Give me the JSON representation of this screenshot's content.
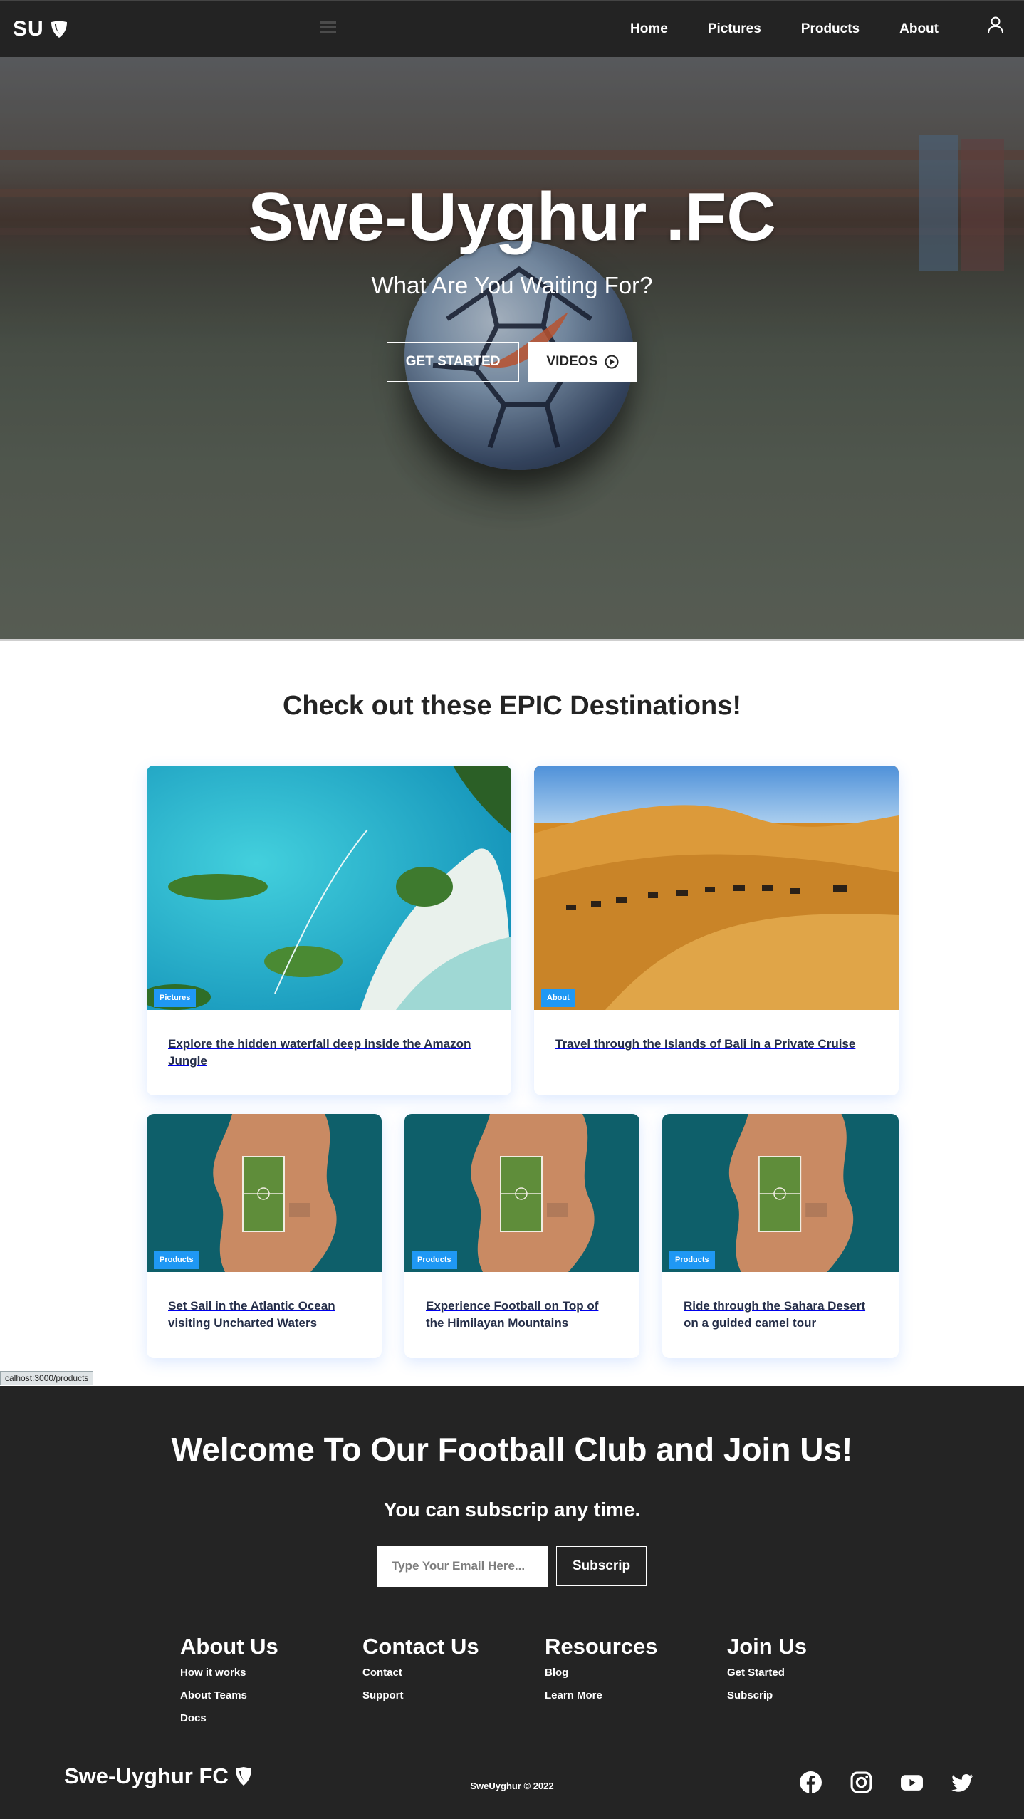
{
  "navbar": {
    "logo_text": "SU",
    "links": [
      "Home",
      "Pictures",
      "Products",
      "About"
    ]
  },
  "hero": {
    "title": "Swe-Uyghur .FC",
    "subtitle": "What Are You Waiting For?",
    "get_started": "GET STARTED",
    "videos": "VIDEOS"
  },
  "destinations": {
    "title": "Check out these EPIC Destinations!",
    "cards": [
      {
        "badge": "Pictures",
        "text": "Explore the hidden waterfall deep inside the Amazon Jungle"
      },
      {
        "badge": "About",
        "text": "Travel through the Islands of Bali in a Private Cruise"
      },
      {
        "badge": "Products",
        "text": "Set Sail in the Atlantic Ocean visiting Uncharted Waters"
      },
      {
        "badge": "Products",
        "text": "Experience Football on Top of the Himilayan Mountains"
      },
      {
        "badge": "Products",
        "text": "Ride through the Sahara Desert on a guided camel tour"
      }
    ]
  },
  "status_tooltip": "calhost:3000/products",
  "footer": {
    "heading": "Welcome To Our Football Club and Join Us!",
    "subheading": "You can subscrip any time.",
    "email_placeholder": "Type Your Email Here...",
    "subscribe": "Subscrip",
    "columns": [
      {
        "title": "About Us",
        "links": [
          "How it works",
          "About Teams",
          "Docs"
        ]
      },
      {
        "title": "Contact Us",
        "links": [
          "Contact",
          "Support"
        ]
      },
      {
        "title": "Resources",
        "links": [
          "Blog",
          "Learn More"
        ]
      },
      {
        "title": "Join Us",
        "links": [
          "Get Started",
          "Subscrip"
        ]
      }
    ],
    "logo_text": "Swe-Uyghur FC",
    "copyright": "SweUyghur © 2022",
    "social_icons": [
      "facebook-icon",
      "instagram-icon",
      "youtube-icon",
      "twitter-icon"
    ]
  },
  "colors": {
    "dark": "#242424",
    "badge": "#1f98f4",
    "card_text": "#252e48"
  }
}
